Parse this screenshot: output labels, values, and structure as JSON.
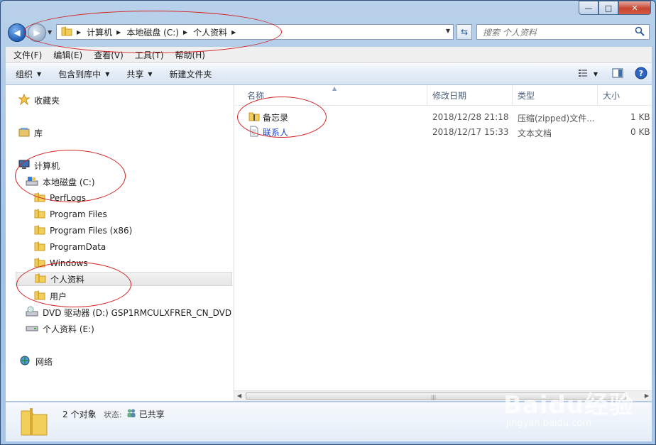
{
  "window": {
    "caption_buttons": {
      "minimize": "—",
      "maximize": "□",
      "close": "✕"
    }
  },
  "address_bar": {
    "crumbs": [
      "计算机",
      "本地磁盘 (C:)",
      "个人资料"
    ]
  },
  "search": {
    "placeholder": "搜索 个人资料"
  },
  "menu": [
    "文件(F)",
    "编辑(E)",
    "查看(V)",
    "工具(T)",
    "帮助(H)"
  ],
  "toolbar": {
    "organize": "组织",
    "include_library": "包含到库中",
    "share": "共享",
    "new_folder": "新建文件夹"
  },
  "nav_pane": {
    "favorites": "收藏夹",
    "libraries": "库",
    "computer": "计算机",
    "local_disk": "本地磁盘 (C:)",
    "folders": [
      "PerfLogs",
      "Program Files",
      "Program Files (x86)",
      "ProgramData",
      "Windows",
      "个人资料",
      "用户"
    ],
    "selected": "个人资料",
    "dvd": "DVD 驱动器 (D:) GSP1RMCULXFRER_CN_DVD",
    "drive_e": "个人资料 (E:)",
    "network": "网络"
  },
  "columns": {
    "name": "名称",
    "date": "修改日期",
    "type": "类型",
    "size": "大小"
  },
  "files": [
    {
      "name": "备忘录",
      "date": "2018/12/28 21:18",
      "type": "压缩(zipped)文件...",
      "size": "1 KB",
      "icon": "zip-folder-icon"
    },
    {
      "name": "联系人",
      "date": "2018/12/17 15:33",
      "type": "文本文档",
      "size": "0 KB",
      "icon": "text-file-icon"
    }
  ],
  "details_pane": {
    "count": "2 个对象",
    "state_label": "状态:",
    "state_value": "已共享"
  },
  "watermark": {
    "brand": "Baidu经验",
    "url": "jingyan.baidu.com"
  },
  "colors": {
    "accent": "#1f5fb8",
    "annotation": "#d42020",
    "link_text": "#1a3fd4"
  }
}
